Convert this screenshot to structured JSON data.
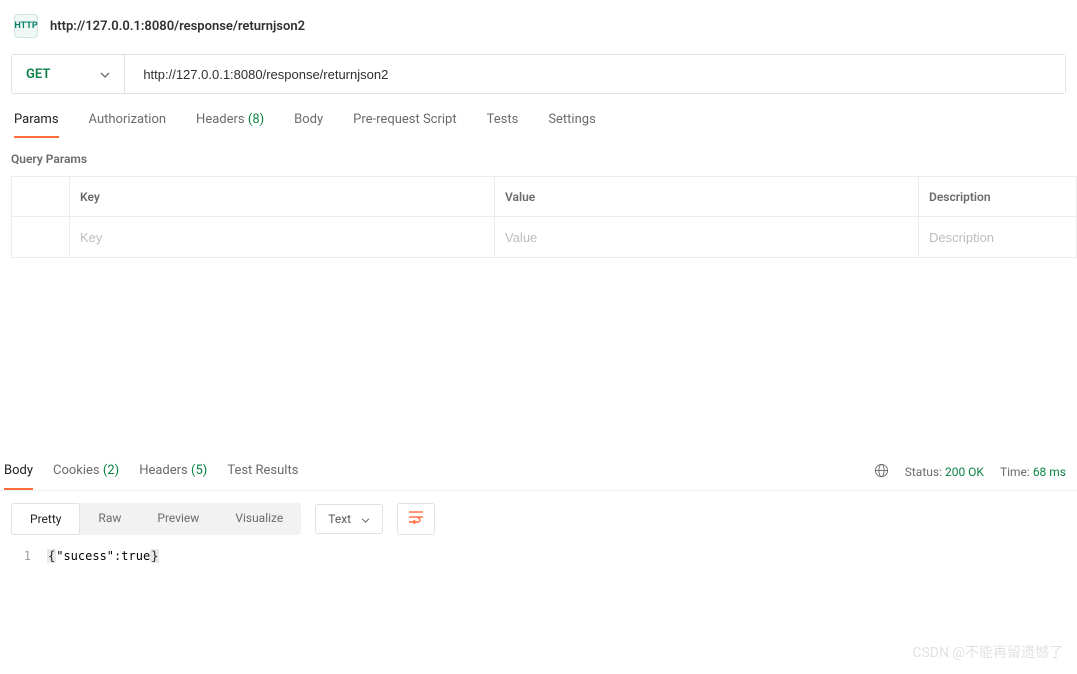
{
  "titlebar": {
    "title": "http://127.0.0.1:8080/response/returnjson2"
  },
  "request": {
    "method": "GET",
    "url": "http://127.0.0.1:8080/response/returnjson2"
  },
  "req_tabs": {
    "params": "Params",
    "authorization": "Authorization",
    "headers_label": "Headers",
    "headers_count": "(8)",
    "body": "Body",
    "prerequest": "Pre-request Script",
    "tests": "Tests",
    "settings": "Settings"
  },
  "query_params": {
    "section_label": "Query Params",
    "headers": {
      "key": "Key",
      "value": "Value",
      "desc": "Description"
    },
    "placeholders": {
      "key": "Key",
      "value": "Value",
      "desc": "Description"
    }
  },
  "resp_tabs": {
    "body": "Body",
    "cookies_label": "Cookies",
    "cookies_count": "(2)",
    "headers_label": "Headers",
    "headers_count": "(5)",
    "test_results": "Test Results"
  },
  "resp_meta": {
    "status_label": "Status:",
    "status_value": "200 OK",
    "time_label": "Time:",
    "time_value": "68 ms"
  },
  "body_views": {
    "pretty": "Pretty",
    "raw": "Raw",
    "preview": "Preview",
    "visualize": "Visualize",
    "lang": "Text"
  },
  "response_body": {
    "line_number": "1",
    "open_brace": "{",
    "key": "\"sucess\"",
    "colon": ":",
    "value": "true",
    "close_brace": "}"
  },
  "watermark": "CSDN @不能再留遗憾了"
}
